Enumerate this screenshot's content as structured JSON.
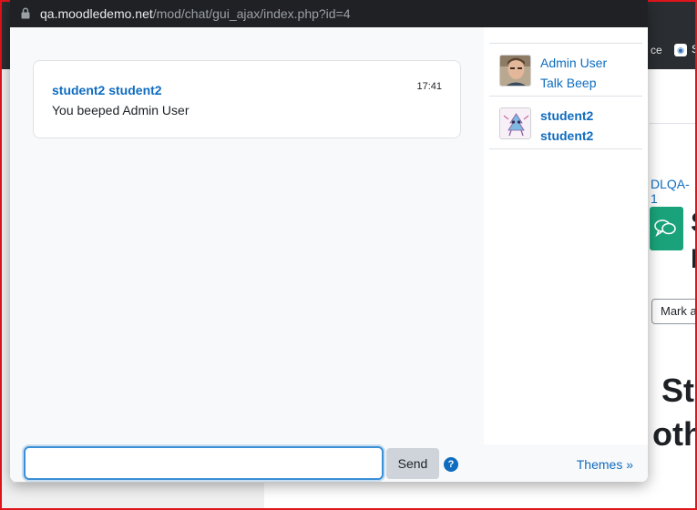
{
  "popup": {
    "url_domain": "qa.moodledemo.net",
    "url_path": "/mod/chat/gui_ajax/index.php?id=4"
  },
  "messages": [
    {
      "sender": "student2 student2",
      "time": "17:41",
      "text": "You beeped Admin User"
    }
  ],
  "users": [
    {
      "name": "Admin User",
      "action": "Talk",
      "beep": "Beep",
      "avatar": "admin-photo"
    },
    {
      "name_first": "student2",
      "name_last": "student2",
      "avatar": "student-cartoon"
    }
  ],
  "input": {
    "value": "",
    "placeholder": ""
  },
  "send_label": "Send",
  "help_symbol": "?",
  "themes_label": "Themes »",
  "background": {
    "toolbar_text": "ce",
    "toolbar_text2": "S",
    "course_code": "DLQA-1",
    "title_letters": [
      "S",
      "F"
    ],
    "mark_button": "Mark a",
    "big_text_line1": "Stu",
    "big_text_line2": "oth"
  },
  "colors": {
    "link": "#0f6cbf",
    "input_focus": "#3a8fd6",
    "frame_border": "#e0141b",
    "chat_tile": "#1aa37a"
  }
}
